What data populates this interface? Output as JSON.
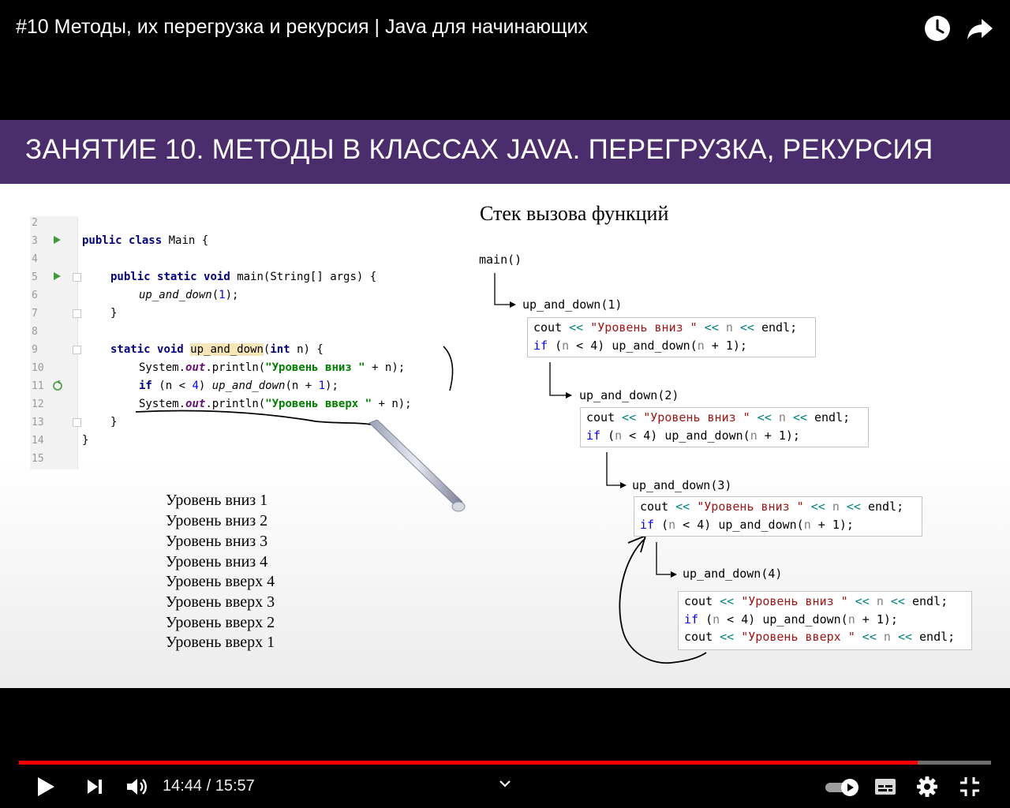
{
  "video": {
    "title": "#10 Методы, их перегрузка и рекурсия | Java для начинающих",
    "current_time": "14:44",
    "time_separator": " / ",
    "duration": "15:57",
    "progress": 0.9249
  },
  "slide": {
    "banner": "ЗАНЯТИЕ 10. МЕТОДЫ В КЛАССАХ JAVA. ПЕРЕГРУЗКА, РЕКУРСИЯ",
    "editor": {
      "line_numbers": [
        "2",
        "3",
        "4",
        "5",
        "6",
        "7",
        "8",
        "9",
        "10",
        "11",
        "12",
        "13",
        "14",
        "15"
      ],
      "class_decl": {
        "kw1": "public",
        "kw2": "class",
        "name": "Main",
        "brace": "{"
      },
      "main_decl": {
        "kw1": "public",
        "kw2": "static",
        "kw3": "void",
        "sig": "main(String[] args) {"
      },
      "main_call": {
        "fn": "up_and_down",
        "open": "(",
        "arg": "1",
        "close": ");"
      },
      "close_brace": "}",
      "method_decl": {
        "kw1": "static",
        "kw2": "void",
        "name": "up_and_down",
        "open": "(",
        "kw3": "int",
        "rest": "n) {"
      },
      "print_down": {
        "a": "System.",
        "field": "out",
        "b": ".println(",
        "str": "\"Уровень вниз \"",
        "c": " + n);"
      },
      "if_line": {
        "kw": "if",
        "a": " (n < ",
        "num": "4",
        "b": ") ",
        "fn": "up_and_down",
        "c": "(n + ",
        "num2": "1",
        "d": ");"
      },
      "print_up": {
        "a": "System.",
        "field": "out",
        "b": ".println(",
        "str": "\"Уровень вверх \"",
        "c": " + n);"
      }
    },
    "output": [
      "Уровень вниз 1",
      "Уровень вниз 2",
      "Уровень вниз 3",
      "Уровень вниз 4",
      "Уровень вверх 4",
      "Уровень вверх 3",
      "Уровень вверх 2",
      "Уровень вверх 1"
    ],
    "stack": {
      "title": "Стек вызова функций",
      "root": "main()",
      "levels": [
        {
          "call": "up_and_down(1)"
        },
        {
          "call": "up_and_down(2)"
        },
        {
          "call": "up_and_down(3)"
        },
        {
          "call": "up_and_down(4)"
        }
      ],
      "cout_line": {
        "a": "cout ",
        "op": "<<",
        "str_down": "\"Уровень вниз \"",
        "str_up": "\"Уровень вверх \"",
        "n": "n",
        "endl": "endl;"
      },
      "if_line": {
        "kw": "if",
        "a": " (",
        "n": "n",
        "b": " < 4) up_and_down(",
        "c": " + 1);"
      }
    }
  },
  "colors": {
    "banner": "#4b2d6e",
    "progress_played": "#ff0000",
    "progress_track": "#6d6d6d"
  },
  "icons": [
    "watch-later-icon",
    "share-icon",
    "play-icon",
    "next-icon",
    "volume-icon",
    "chevron-up-icon",
    "autoplay-toggle-icon",
    "subtitles-icon",
    "settings-icon",
    "exit-fullscreen-icon"
  ]
}
